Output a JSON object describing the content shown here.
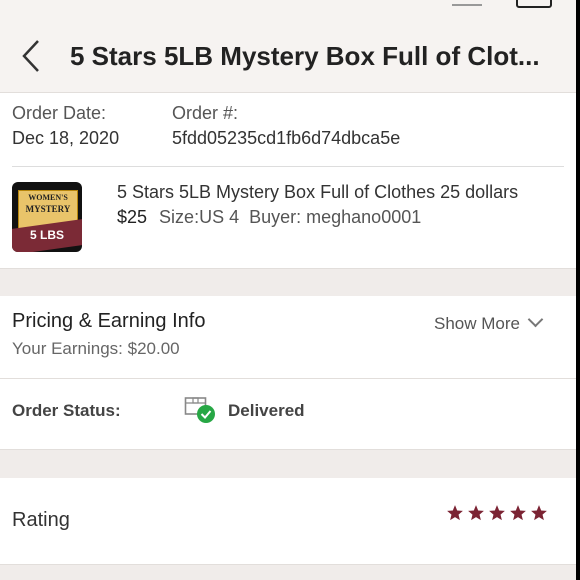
{
  "header": {
    "title": "5 Stars 5LB Mystery Box Full of Clot..."
  },
  "order": {
    "date_label": "Order Date:",
    "date_value": "Dec 18, 2020",
    "number_label": "Order #:",
    "number_value": "5fdd05235cd1fb6d74dbca5e"
  },
  "item": {
    "thumbnail_text_top": "WOMEN'S",
    "thumbnail_text_mid": "MYSTERY",
    "thumbnail_text_bottom": "5 LBS",
    "title": "5 Stars 5LB Mystery Box Full of Clothes 25 dollars",
    "price": "$25",
    "size": "Size:US 4",
    "buyer": "Buyer: meghano0001"
  },
  "pricing": {
    "title": "Pricing & Earning Info",
    "earnings": "Your Earnings: $20.00",
    "show_more": "Show More"
  },
  "status": {
    "label": "Order Status:",
    "value": "Delivered",
    "icon": "package-delivered-icon",
    "check_color": "#27a745"
  },
  "rating": {
    "label": "Rating",
    "stars": 5,
    "star_color": "#7b2333"
  },
  "colors": {
    "background": "#f6f3f1",
    "card": "#ffffff",
    "accent": "#7b2333"
  }
}
